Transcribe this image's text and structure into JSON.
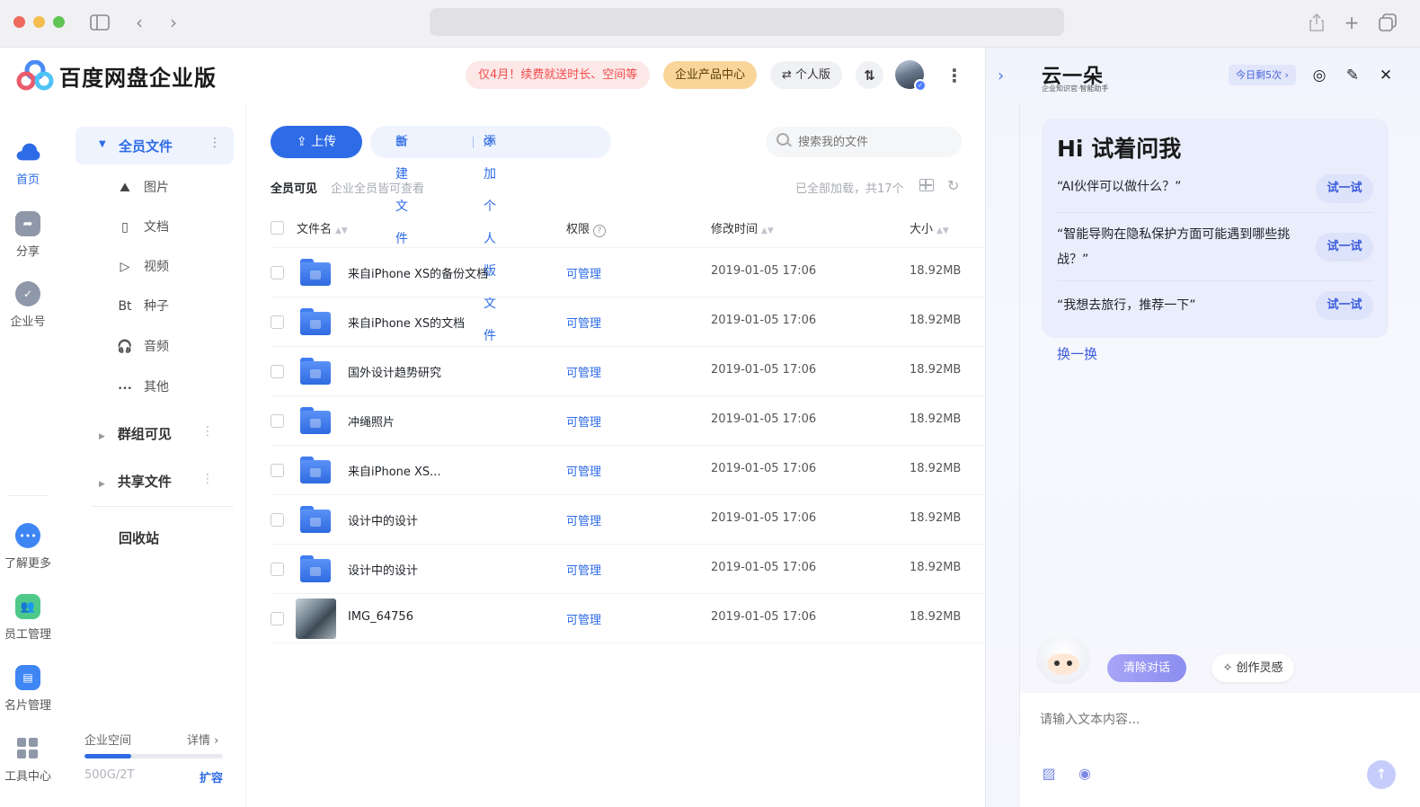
{
  "app": {
    "brand": "百度网盘企业版",
    "promo": "仅4月！续费就送时长、空间等",
    "product_center": "企业产品中心",
    "personal": "个人版"
  },
  "rail": {
    "items": [
      {
        "label": "首页",
        "icon": "cloud-icon",
        "active": true
      },
      {
        "label": "分享",
        "icon": "share-folder-icon"
      },
      {
        "label": "企业号",
        "icon": "badge-icon"
      },
      {
        "label": "了解更多",
        "icon": "chat-more-icon"
      },
      {
        "label": "员工管理",
        "icon": "people-icon"
      },
      {
        "label": "名片管理",
        "icon": "card-icon"
      },
      {
        "label": "工具中心",
        "icon": "grid-icon"
      }
    ]
  },
  "nav": {
    "all_files": "全员文件",
    "sub": [
      {
        "label": "图片",
        "icon": "image-icon",
        "glyph": "⛰"
      },
      {
        "label": "文档",
        "icon": "document-icon",
        "glyph": "▯"
      },
      {
        "label": "视频",
        "icon": "play-icon",
        "glyph": "▷"
      },
      {
        "label": "种子",
        "icon": "bt-icon",
        "glyph": "Bt"
      },
      {
        "label": "音频",
        "icon": "headphones-icon",
        "glyph": "🎧"
      },
      {
        "label": "其他",
        "icon": "more-dots-icon",
        "glyph": "•••"
      }
    ],
    "group_visible": "群组可见",
    "shared_files": "共享文件",
    "recycle": "回收站",
    "space_label": "企业空间",
    "space_detail": "详情 ›",
    "space_used": "500G/2T",
    "space_expand": "扩容",
    "space_fraction": 0.34
  },
  "main": {
    "upload": "上传",
    "new_file": "新建文件",
    "add_personal": "添加个人版文件",
    "search_placeholder": "搜索我的文件",
    "scope": "全员可见",
    "scope_desc": "企业全员皆可查看",
    "loaded": "已全部加载，共17个",
    "columns": {
      "name": "文件名",
      "perm": "权限",
      "time": "修改时间",
      "size": "大小"
    },
    "rows": [
      {
        "name": "来自iPhone XS的备份文档",
        "perm": "可管理",
        "time": "2019-01-05 17:06",
        "size": "18.92MB",
        "type": "folder"
      },
      {
        "name": "来自iPhone XS的文档",
        "perm": "可管理",
        "time": "2019-01-05 17:06",
        "size": "18.92MB",
        "type": "folder"
      },
      {
        "name": "国外设计趋势研究",
        "perm": "可管理",
        "time": "2019-01-05 17:06",
        "size": "18.92MB",
        "type": "folder"
      },
      {
        "name": "冲绳照片",
        "perm": "可管理",
        "time": "2019-01-05 17:06",
        "size": "18.92MB",
        "type": "folder"
      },
      {
        "name": "来自iPhone XS...",
        "perm": "可管理",
        "time": "2019-01-05 17:06",
        "size": "18.92MB",
        "type": "folder"
      },
      {
        "name": "设计中的设计",
        "perm": "可管理",
        "time": "2019-01-05 17:06",
        "size": "18.92MB",
        "type": "folder"
      },
      {
        "name": "设计中的设计",
        "perm": "可管理",
        "time": "2019-01-05 17:06",
        "size": "18.92MB",
        "type": "folder"
      },
      {
        "name": "IMG_64756",
        "perm": "可管理",
        "time": "2019-01-05 17:06",
        "size": "18.92MB",
        "type": "image"
      }
    ]
  },
  "ai": {
    "logo": "云一朵",
    "logo_sub": "企业知识官·智能助手",
    "quota": "今日剩5次 ›",
    "greeting": "Hi 试着问我",
    "suggestions": [
      {
        "text": "“AI伙伴可以做什么？”",
        "btn": "试一试"
      },
      {
        "text": "“智能导购在隐私保护方面可能遇到哪些挑战？”",
        "btn": "试一试"
      },
      {
        "text": "“我想去旅行，推荐一下”",
        "btn": "试一试"
      }
    ],
    "refresh": "换一换",
    "clear": "清除对话",
    "inspire": "创作灵感",
    "input_placeholder": "请输入文本内容..."
  },
  "colors": {
    "accent": "#2e6be6",
    "promo_red": "#f04c4c",
    "gold": "#f9d59a"
  }
}
